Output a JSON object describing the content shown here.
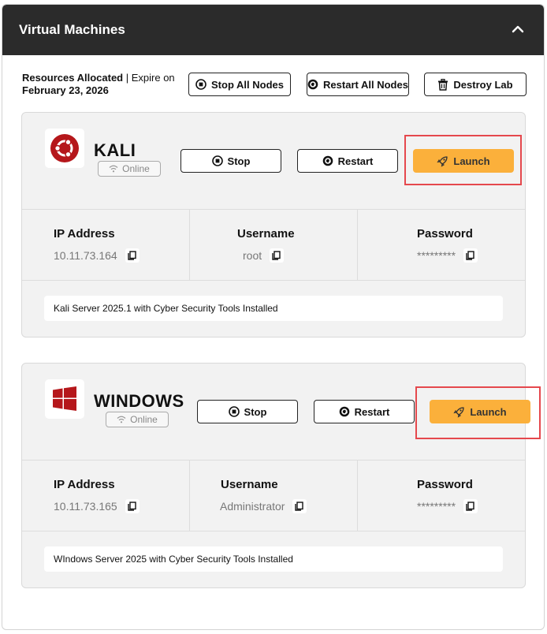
{
  "header": {
    "title": "Virtual Machines"
  },
  "resources": {
    "label": "Resources Allocated",
    "separator": " | ",
    "expire_label": "Expire on",
    "expire_date": "February 23, 2026"
  },
  "toolbar": {
    "stop_all_label": "Stop All Nodes",
    "restart_all_label": "Restart All Nodes",
    "destroy_label": "Destroy Lab"
  },
  "machines": [
    {
      "name": "KALI",
      "status": "Online",
      "stop_label": "Stop",
      "restart_label": "Restart",
      "launch_label": "Launch",
      "ip_label": "IP Address",
      "ip": "10.11.73.164",
      "username_label": "Username",
      "username": "root",
      "password_label": "Password",
      "password": "*********",
      "description": "Kali Server 2025.1 with Cyber Security Tools Installed",
      "logo_icon": "ubuntu-logo-icon",
      "logo_color": "#b5171b"
    },
    {
      "name": "WINDOWS",
      "status": "Online",
      "stop_label": "Stop",
      "restart_label": "Restart",
      "launch_label": "Launch",
      "ip_label": "IP Address",
      "ip": "10.11.73.165",
      "username_label": "Username",
      "username": "Administrator",
      "password_label": "Password",
      "password": "*********",
      "description": "WIndows Server 2025 with Cyber Security Tools Installed",
      "logo_icon": "windows-logo-icon",
      "logo_color": "#b5171b"
    }
  ],
  "colors": {
    "header_bg": "#2b2b2b",
    "launch": "#fbb03b",
    "highlight": "#e5484d"
  }
}
